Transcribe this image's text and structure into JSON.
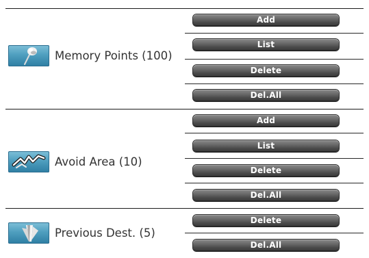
{
  "sections": [
    {
      "label": "Memory Points (100)",
      "icon": "pushpin-icon",
      "buttons": [
        "Add",
        "List",
        "Delete",
        "Del.All"
      ]
    },
    {
      "label": "Avoid Area (10)",
      "icon": "avoid-area-icon",
      "buttons": [
        "Add",
        "List",
        "Delete",
        "Del.All"
      ]
    },
    {
      "label": "Previous Dest. (5)",
      "icon": "previous-dest-icon",
      "buttons": [
        "Delete",
        "Del.All"
      ]
    }
  ],
  "colors": {
    "icon_background": "#4f9fbf",
    "button": "#5a5a5a",
    "button_text": "#ffffff",
    "label_text": "#333333",
    "divider": "#1a1a1a"
  }
}
